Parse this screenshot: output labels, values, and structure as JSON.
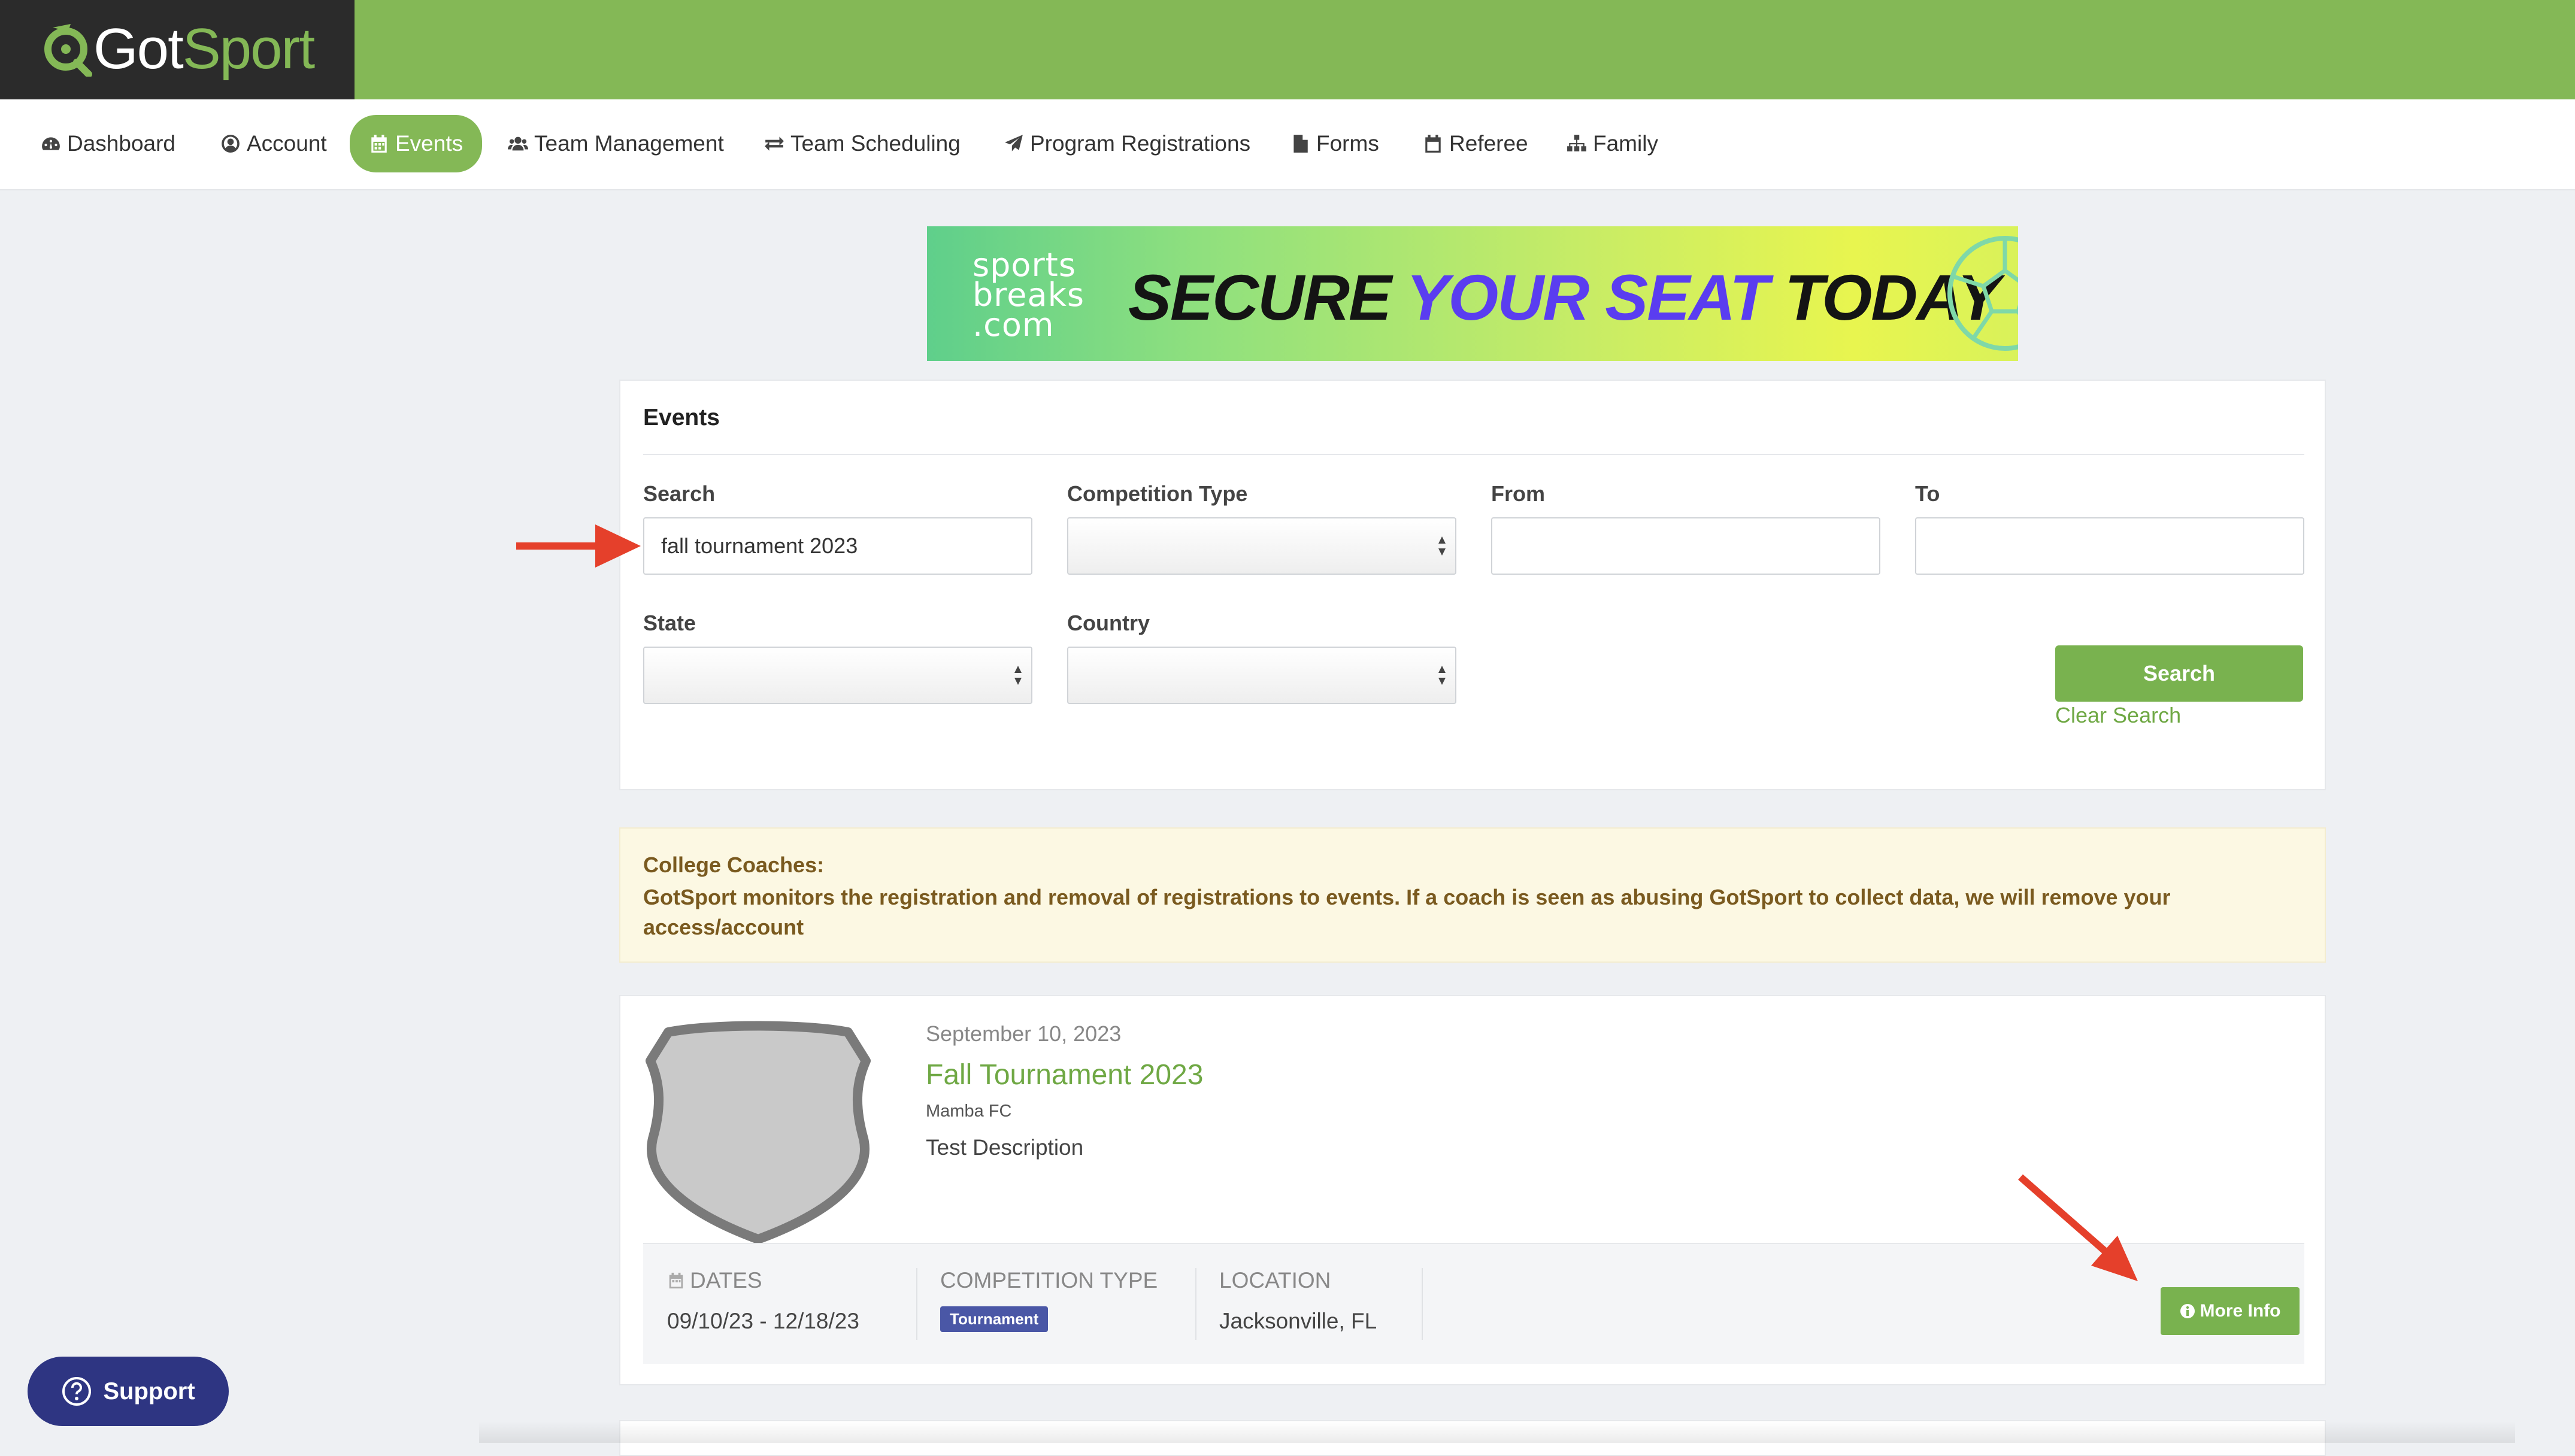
{
  "brand": {
    "name_part1": "Got",
    "name_part2": "Sport"
  },
  "nav": {
    "items": [
      {
        "label": "Dashboard",
        "icon": "dashboard-icon"
      },
      {
        "label": "Account",
        "icon": "user-circle-icon"
      },
      {
        "label": "Events",
        "icon": "calendar-icon",
        "active": true
      },
      {
        "label": "Team Management",
        "icon": "users-icon"
      },
      {
        "label": "Team Scheduling",
        "icon": "exchange-icon"
      },
      {
        "label": "Program Registrations",
        "icon": "paper-plane-icon"
      },
      {
        "label": "Forms",
        "icon": "file-icon"
      },
      {
        "label": "Referee",
        "icon": "calendar-icon"
      },
      {
        "label": "Family",
        "icon": "sitemap-icon"
      }
    ]
  },
  "banner": {
    "brand_line1": "sports",
    "brand_line2": "breaks",
    "brand_line3": ".com",
    "headline_1": "SECURE",
    "headline_2": "YOUR SEAT",
    "headline_3": "TODAY"
  },
  "events_panel": {
    "title": "Events",
    "search_label": "Search",
    "search_value": "fall tournament 2023",
    "competition_type_label": "Competition Type",
    "competition_type_value": "",
    "from_label": "From",
    "from_value": "",
    "to_label": "To",
    "to_value": "",
    "state_label": "State",
    "state_value": "",
    "country_label": "Country",
    "country_value": "",
    "search_button": "Search",
    "clear_search": "Clear Search"
  },
  "notice": {
    "title": "College Coaches:",
    "body": "GotSport monitors the registration and removal of registrations to events. If a coach is seen as abusing GotSport to collect data, we will remove your access/account"
  },
  "results": [
    {
      "date": "September 10, 2023",
      "title": "Fall Tournament 2023",
      "organization": "Mamba FC",
      "description": "Test Description",
      "dates_label": "DATES",
      "dates_value": "09/10/23 - 12/18/23",
      "competition_type_label": "COMPETITION TYPE",
      "competition_type_badge": "Tournament",
      "location_label": "LOCATION",
      "location_value": "Jacksonville, FL",
      "more_info_button": "More Info"
    }
  ],
  "support": {
    "label": "Support"
  },
  "colors": {
    "brand_green": "#84b856",
    "button_green": "#79b24f",
    "link_green": "#6fa844",
    "dark_header": "#2b2b2b",
    "badge_blue": "#4a57a6",
    "support_navy": "#2e3582",
    "annotation_red": "#e5402b"
  }
}
